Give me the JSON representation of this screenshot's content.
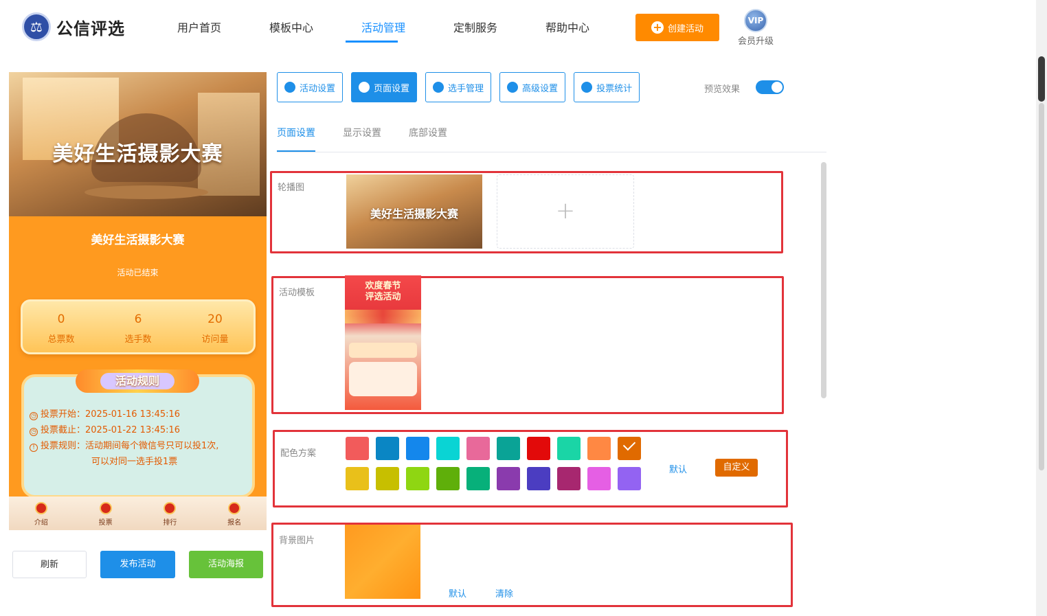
{
  "app": {
    "logo_text": "公信评选",
    "logo_icon": "scale-icon"
  },
  "nav": [
    "用户首页",
    "模板中心",
    "活动管理",
    "定制服务",
    "帮助中心"
  ],
  "nav_active": "活动管理",
  "header": {
    "create_label": "创建活动",
    "vip_badge": "VIP",
    "vip_label": "会员升级"
  },
  "preview": {
    "banner_title": "美好生活摄影大赛",
    "event_title": "美好生活摄影大赛",
    "status": "活动已结束",
    "stats": [
      {
        "value": "0",
        "label": "总票数"
      },
      {
        "value": "6",
        "label": "选手数"
      },
      {
        "value": "20",
        "label": "访问量"
      }
    ],
    "rules_title": "活动规则",
    "rules": [
      "投票开始：2025-01-16 13:45:16",
      "投票截止：2025-01-22 13:45:16",
      "投票规则：活动期间每个微信号只可以投1次,",
      "可以对同一选手投1票"
    ],
    "tabbar": [
      "介绍",
      "投票",
      "排行",
      "报名"
    ]
  },
  "actions": {
    "refresh": "刷新",
    "publish": "发布活动",
    "poster": "活动海报"
  },
  "settings_tabs": [
    {
      "label": "活动设置",
      "icon": "star-icon"
    },
    {
      "label": "页面设置",
      "icon": "gear-icon"
    },
    {
      "label": "选手管理",
      "icon": "users-icon"
    },
    {
      "label": "高级设置",
      "icon": "sliders-icon"
    },
    {
      "label": "投票统计",
      "icon": "bar-chart-icon"
    }
  ],
  "settings_active": "页面设置",
  "preview_toggle": {
    "label": "预览效果",
    "on": true
  },
  "subtabs": [
    "页面设置",
    "显示设置",
    "底部设置"
  ],
  "sections": {
    "carousel": {
      "label": "轮播图",
      "image_text": "美好生活摄影大赛",
      "upload_symbol": "+"
    },
    "template": {
      "label": "活动模板",
      "image_text": "欢度春节\n评选活动"
    },
    "colors": {
      "label": "配色方案",
      "swatches": [
        "#f25b5b",
        "#0a86c4",
        "#1487ec",
        "#0ad4d4",
        "#e8699a",
        "#0aa396",
        "#e20a0a",
        "#1ad5a6",
        "#ff8843",
        "#e06a00",
        "#e9c01a",
        "#c7bf00",
        "#8fd612",
        "#5faf0a",
        "#07b07a",
        "#8a3bad",
        "#4b3dc1",
        "#a7276f",
        "#e55fe4",
        "#9363f2"
      ],
      "selected_index": 9,
      "default_label": "默认",
      "custom_label": "自定义"
    },
    "background": {
      "label": "背景图片",
      "default_label": "默认",
      "clear_label": "清除"
    }
  }
}
